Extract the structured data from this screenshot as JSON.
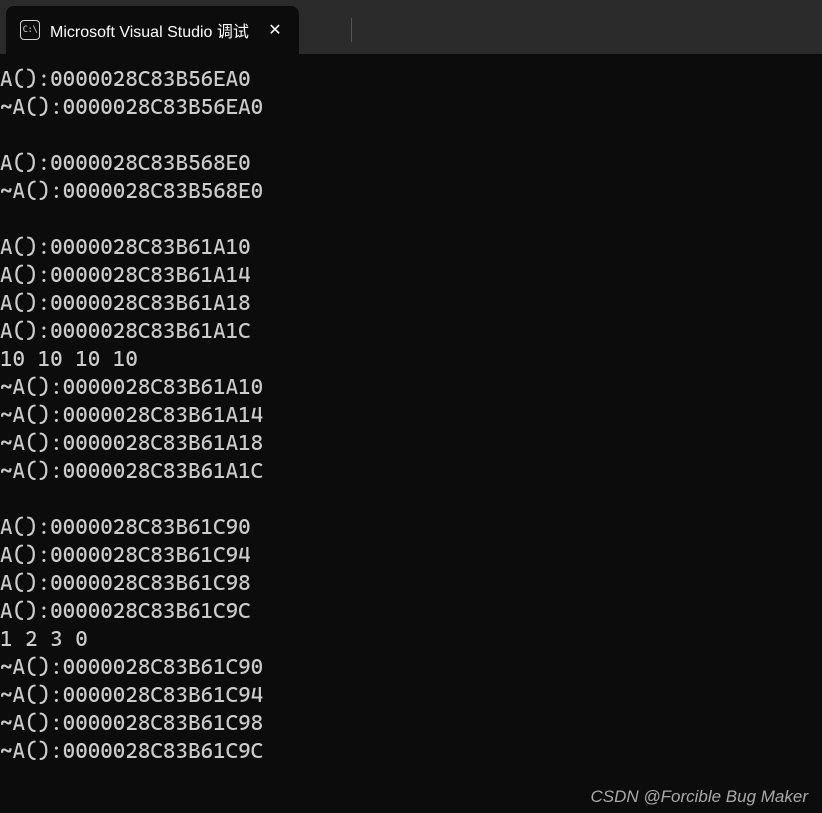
{
  "tab": {
    "icon_label": "C:\\",
    "title": "Microsoft Visual Studio 调试",
    "close_symbol": "✕"
  },
  "titlebar": {
    "new_tab_symbol": "+",
    "dropdown_symbol": "⌄"
  },
  "console_lines": [
    "A():0000028C83B56EA0",
    "~A():0000028C83B56EA0",
    "",
    "A():0000028C83B568E0",
    "~A():0000028C83B568E0",
    "",
    "A():0000028C83B61A10",
    "A():0000028C83B61A14",
    "A():0000028C83B61A18",
    "A():0000028C83B61A1C",
    "10 10 10 10",
    "~A():0000028C83B61A10",
    "~A():0000028C83B61A14",
    "~A():0000028C83B61A18",
    "~A():0000028C83B61A1C",
    "",
    "A():0000028C83B61C90",
    "A():0000028C83B61C94",
    "A():0000028C83B61C98",
    "A():0000028C83B61C9C",
    "1 2 3 0",
    "~A():0000028C83B61C90",
    "~A():0000028C83B61C94",
    "~A():0000028C83B61C98",
    "~A():0000028C83B61C9C"
  ],
  "watermark": "CSDN @Forcible Bug Maker"
}
